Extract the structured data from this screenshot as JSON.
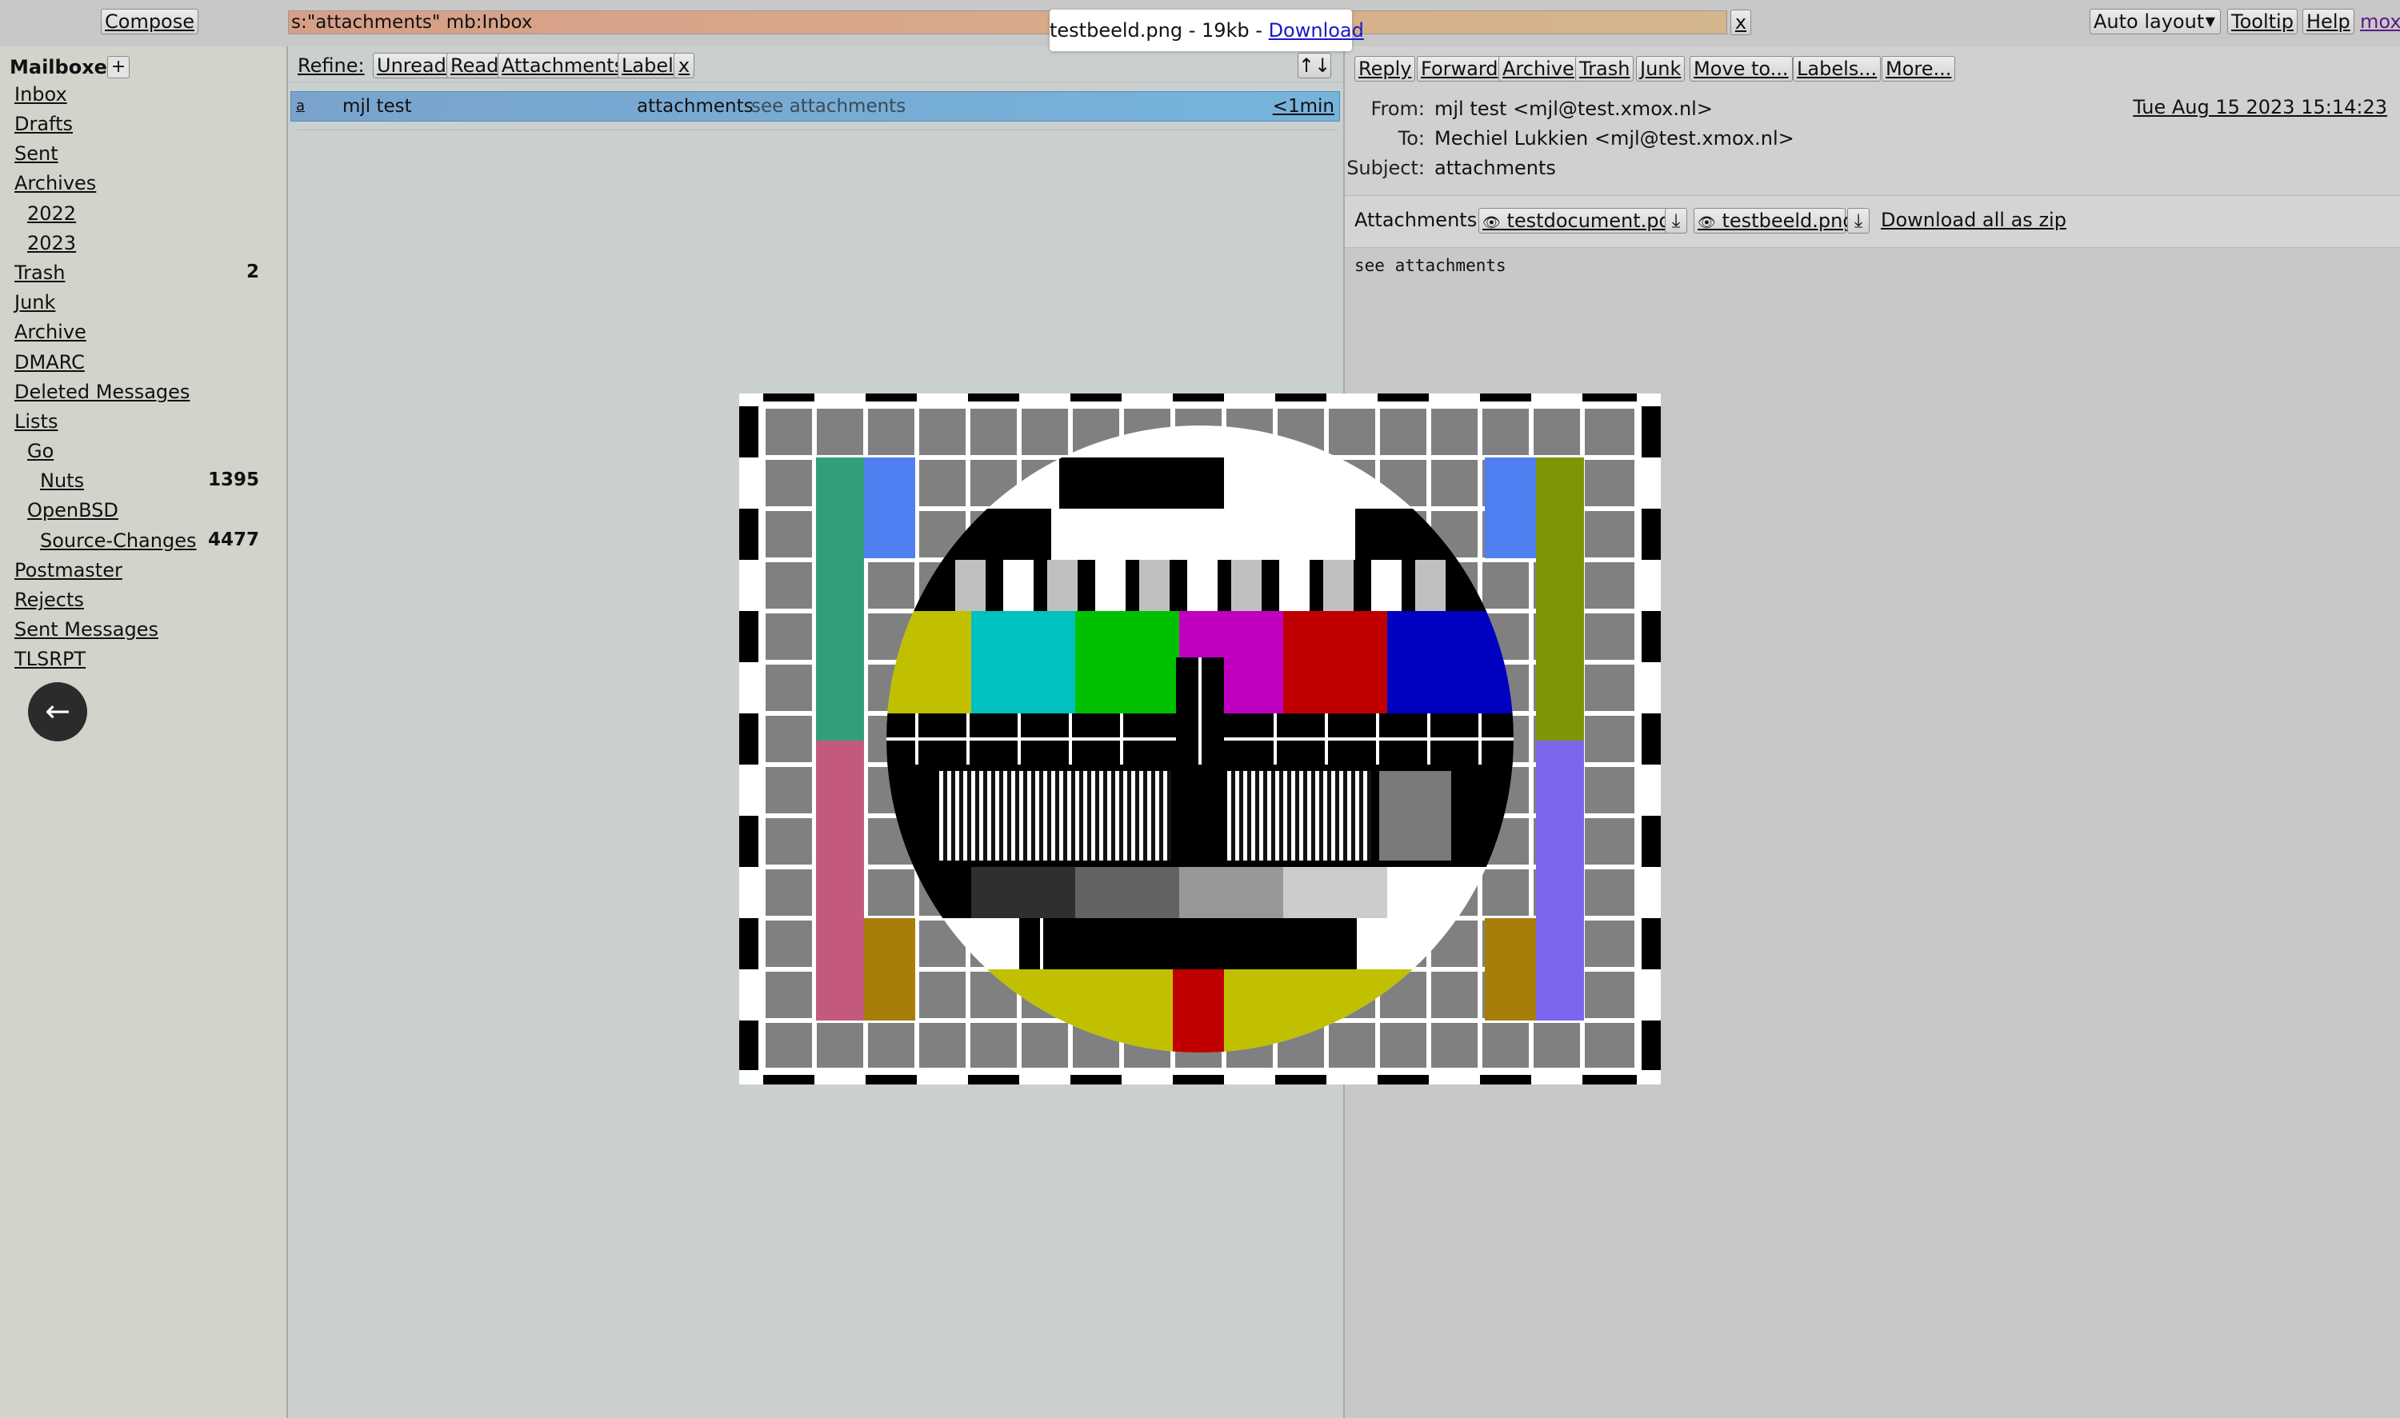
{
  "topbar": {
    "compose_label": "Compose",
    "search_value": "s:\"attachments\" mb:Inbox",
    "search_clear_label": "x",
    "layout_select": "Auto layout",
    "tooltip_label": "Tooltip",
    "help_label": "Help",
    "brand": "mox"
  },
  "popup": {
    "text": "testbeeld.png - 19kb - ",
    "download_label": "Download"
  },
  "sidebar": {
    "title": "Mailboxes",
    "add_label": "+",
    "items": [
      {
        "label": "Inbox",
        "count": ""
      },
      {
        "label": "Drafts",
        "count": ""
      },
      {
        "label": "Sent",
        "count": ""
      },
      {
        "label": "Archives",
        "count": ""
      },
      {
        "label": "2022",
        "count": ""
      },
      {
        "label": "2023",
        "count": ""
      },
      {
        "label": "Trash",
        "count": "2"
      },
      {
        "label": "Junk",
        "count": ""
      },
      {
        "label": "Archive",
        "count": ""
      },
      {
        "label": "DMARC",
        "count": ""
      },
      {
        "label": "Deleted Messages",
        "count": ""
      },
      {
        "label": "Lists",
        "count": ""
      },
      {
        "label": "Go",
        "count": ""
      },
      {
        "label": "Nuts",
        "count": "1395"
      },
      {
        "label": "OpenBSD",
        "count": ""
      },
      {
        "label": "Source-Changes",
        "count": "4477"
      },
      {
        "label": "Postmaster",
        "count": ""
      },
      {
        "label": "Rejects",
        "count": ""
      },
      {
        "label": "Sent Messages",
        "count": ""
      },
      {
        "label": "TLSRPT",
        "count": ""
      }
    ],
    "back_icon": "arrow-left-icon",
    "back_glyph": "←"
  },
  "refine": {
    "label": "Refine:",
    "filters": [
      "Unread",
      "Read",
      "Attachments",
      "Label",
      "x"
    ],
    "sort_label": "↑↓"
  },
  "message_list": [
    {
      "flag": "a",
      "from": "mjl test",
      "subject": "attachments",
      "snippet": "see attachments",
      "age": "<1min"
    }
  ],
  "toolbar": {
    "buttons": [
      "Reply",
      "Forward",
      "Archive",
      "Trash",
      "Junk",
      "Move to...",
      "Labels...",
      "More..."
    ]
  },
  "message": {
    "from_label": "From:",
    "from": "mjl test <mjl@test.xmox.nl>",
    "to_label": "To:",
    "to": "Mechiel Lukkien <mjl@test.xmox.nl>",
    "subject_label": "Subject:",
    "subject": "attachments",
    "date": "Tue Aug 15 2023 15:14:23",
    "attachments_label": "Attachments:",
    "attachments": [
      {
        "name": "testdocument.pdf",
        "download_glyph": "⤓"
      },
      {
        "name": "testbeeld.png",
        "download_glyph": "⤓"
      }
    ],
    "download_all_label": "Download all as zip",
    "body": "see attachments"
  },
  "colors": {
    "accent_row": "#79a3cc",
    "search_bg": "#d79f88",
    "sidebar_bg": "#d3d2cb",
    "list_bg": "#c9d0cf",
    "link": "#1a1ac8"
  }
}
